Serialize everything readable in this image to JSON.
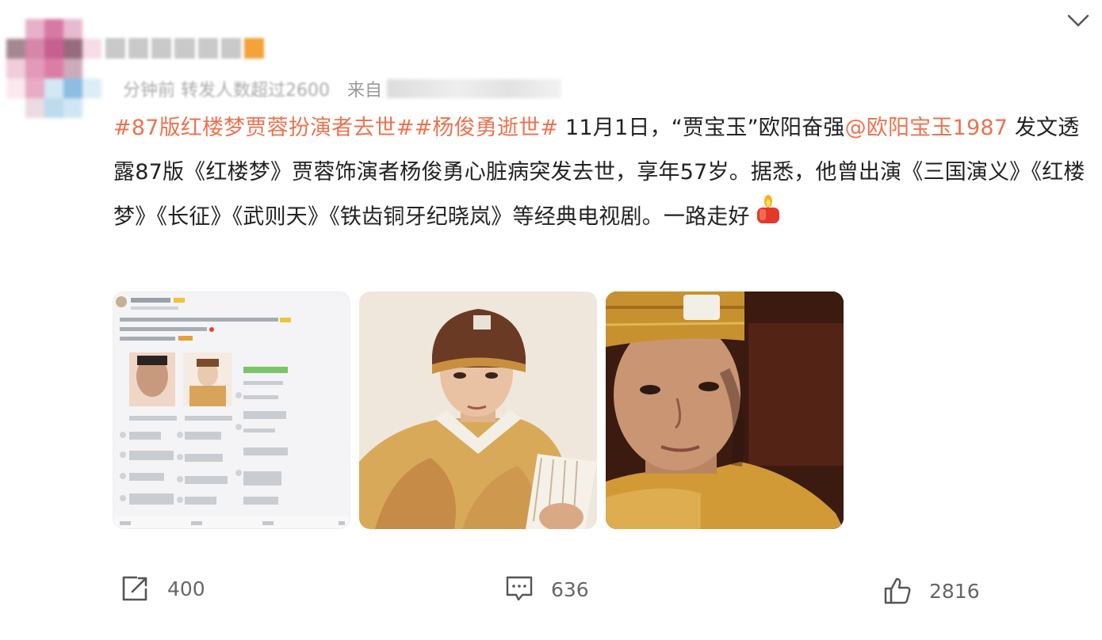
{
  "post": {
    "meta_text": "分钟前 转发人数超过2600",
    "meta_source": "来自",
    "hashtag1": "#87版红楼梦贾蓉扮演者去世#",
    "hashtag2": "#杨俊勇逝世#",
    "text_a": " 11月1日，“贾宝玉”欧阳奋强",
    "mention": "@欧阳宝玉1987",
    "text_b": " 发文透露87版《红楼梦》贾蓉饰演者杨俊勇心脏病突发去世，享年57岁。据悉，他曾出演《三国演义》《红楼梦》《长征》《武则天》《铁齿铜牙纪晓岚》等经典电视剧。一路走好",
    "candle_icon": "candle-emoji"
  },
  "images": [
    {
      "icon": "screenshot-thumbnail"
    },
    {
      "icon": "actor-photo"
    },
    {
      "icon": "actor-closeup-photo"
    }
  ],
  "actions": {
    "repost_count": "400",
    "comment_count": "636",
    "like_count": "2816"
  },
  "colors": {
    "link": "#eb7350",
    "text": "#222222",
    "muted": "#999999",
    "action": "#666666"
  }
}
